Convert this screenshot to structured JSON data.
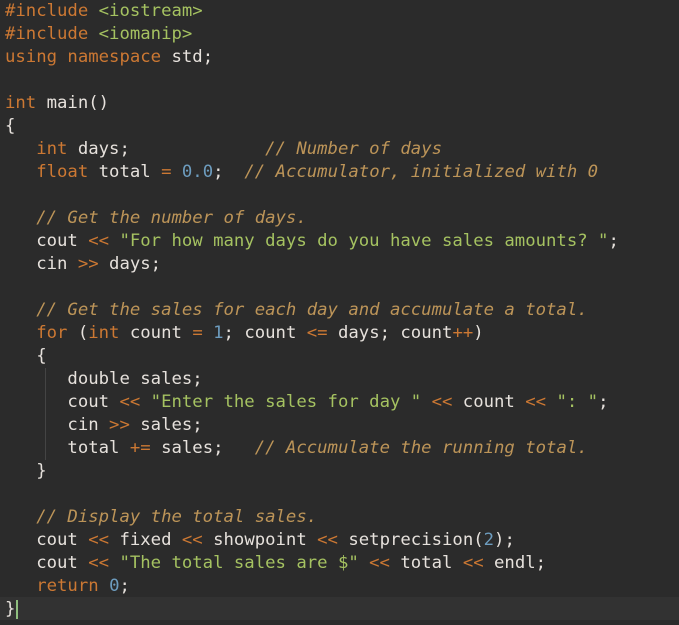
{
  "editor": {
    "language": "C++",
    "caret_line": 27,
    "colors": {
      "background": "#2b2b2b",
      "preprocessor": "#cc7833",
      "keyword": "#cc7833",
      "identifier": "#e6e1dc",
      "operator": "#cc7833",
      "number": "#6d9cbe",
      "string": "#a5c261",
      "comment": "#bc9458",
      "caret": "#8fbf7f"
    },
    "lines": [
      [
        [
          "pp",
          "#include"
        ],
        [
          "id",
          " "
        ],
        [
          "inc",
          "<iostream>"
        ]
      ],
      [
        [
          "pp",
          "#include"
        ],
        [
          "id",
          " "
        ],
        [
          "inc",
          "<iomanip>"
        ]
      ],
      [
        [
          "kw",
          "using namespace"
        ],
        [
          "id",
          " std;"
        ]
      ],
      [],
      [
        [
          "kw",
          "int"
        ],
        [
          "id",
          " main()"
        ]
      ],
      [
        [
          "id",
          "{"
        ]
      ],
      [
        [
          "id",
          "   "
        ],
        [
          "kw",
          "int"
        ],
        [
          "id",
          " days;             "
        ],
        [
          "cmt",
          "// Number of days"
        ]
      ],
      [
        [
          "id",
          "   "
        ],
        [
          "kw",
          "float"
        ],
        [
          "id",
          " total "
        ],
        [
          "op",
          "="
        ],
        [
          "id",
          " "
        ],
        [
          "num",
          "0.0"
        ],
        [
          "id",
          ";  "
        ],
        [
          "cmt",
          "// Accumulator, initialized with 0"
        ]
      ],
      [],
      [
        [
          "id",
          "   "
        ],
        [
          "cmt",
          "// Get the number of days."
        ]
      ],
      [
        [
          "id",
          "   cout "
        ],
        [
          "op",
          "<<"
        ],
        [
          "id",
          " "
        ],
        [
          "str",
          "\"For how many days do you have sales amounts? \""
        ],
        [
          "id",
          ";"
        ]
      ],
      [
        [
          "id",
          "   cin "
        ],
        [
          "op",
          ">>"
        ],
        [
          "id",
          " days;"
        ]
      ],
      [],
      [
        [
          "id",
          "   "
        ],
        [
          "cmt",
          "// Get the sales for each day and accumulate a total."
        ]
      ],
      [
        [
          "id",
          "   "
        ],
        [
          "kw",
          "for"
        ],
        [
          "id",
          " ("
        ],
        [
          "kw",
          "int"
        ],
        [
          "id",
          " count "
        ],
        [
          "op",
          "="
        ],
        [
          "id",
          " "
        ],
        [
          "num",
          "1"
        ],
        [
          "id",
          "; count "
        ],
        [
          "op",
          "<="
        ],
        [
          "id",
          " days; count"
        ],
        [
          "op",
          "++"
        ],
        [
          "id",
          ")"
        ]
      ],
      [
        [
          "id",
          "   {"
        ]
      ],
      [
        [
          "id",
          "      double sales;"
        ]
      ],
      [
        [
          "id",
          "      cout "
        ],
        [
          "op",
          "<<"
        ],
        [
          "id",
          " "
        ],
        [
          "str",
          "\"Enter the sales for day \""
        ],
        [
          "id",
          " "
        ],
        [
          "op",
          "<<"
        ],
        [
          "id",
          " count "
        ],
        [
          "op",
          "<<"
        ],
        [
          "id",
          " "
        ],
        [
          "str",
          "\": \""
        ],
        [
          "id",
          ";"
        ]
      ],
      [
        [
          "id",
          "      cin "
        ],
        [
          "op",
          ">>"
        ],
        [
          "id",
          " sales;"
        ]
      ],
      [
        [
          "id",
          "      total "
        ],
        [
          "op",
          "+="
        ],
        [
          "id",
          " sales;   "
        ],
        [
          "cmt",
          "// Accumulate the running total."
        ]
      ],
      [
        [
          "id",
          "   }"
        ]
      ],
      [],
      [
        [
          "id",
          "   "
        ],
        [
          "cmt",
          "// Display the total sales."
        ]
      ],
      [
        [
          "id",
          "   cout "
        ],
        [
          "op",
          "<<"
        ],
        [
          "id",
          " fixed "
        ],
        [
          "op",
          "<<"
        ],
        [
          "id",
          " showpoint "
        ],
        [
          "op",
          "<<"
        ],
        [
          "id",
          " setprecision("
        ],
        [
          "num",
          "2"
        ],
        [
          "id",
          ");"
        ]
      ],
      [
        [
          "id",
          "   cout "
        ],
        [
          "op",
          "<<"
        ],
        [
          "id",
          " "
        ],
        [
          "str",
          "\"The total sales are $\""
        ],
        [
          "id",
          " "
        ],
        [
          "op",
          "<<"
        ],
        [
          "id",
          " total "
        ],
        [
          "op",
          "<<"
        ],
        [
          "id",
          " endl;"
        ]
      ],
      [
        [
          "id",
          "   "
        ],
        [
          "kw",
          "return"
        ],
        [
          "id",
          " "
        ],
        [
          "num",
          "0"
        ],
        [
          "id",
          ";"
        ]
      ],
      [
        [
          "id",
          "}"
        ]
      ]
    ]
  }
}
